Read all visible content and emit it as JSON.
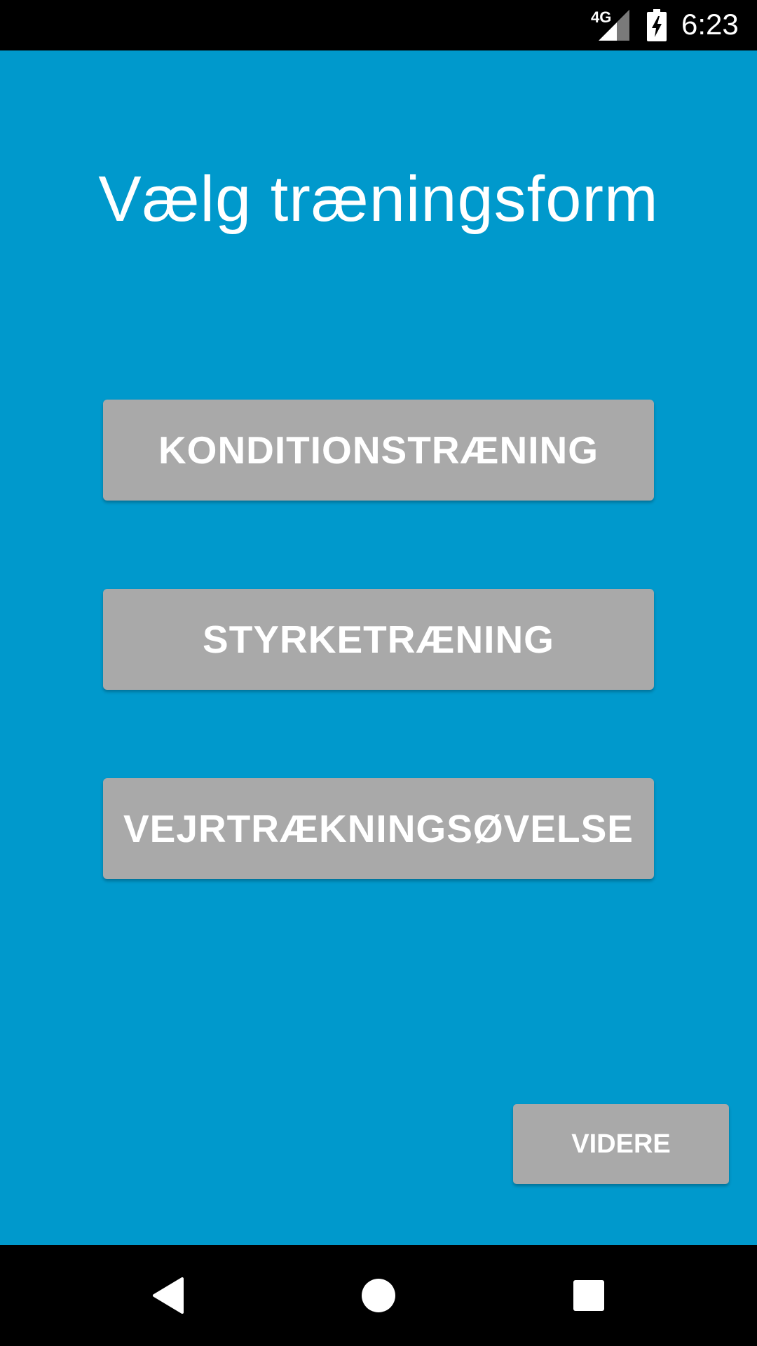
{
  "status_bar": {
    "network": "4G",
    "clock": "6:23",
    "icons": [
      "signal-icon",
      "battery-charging-icon"
    ]
  },
  "screen": {
    "title": "Vælg træningsform",
    "options": [
      {
        "label": "KONDITIONSTRÆNING"
      },
      {
        "label": "STYRKETRÆNING"
      },
      {
        "label": "VEJRTRÆKNINGSØVELSE"
      }
    ],
    "next_label": "VIDERE"
  },
  "nav_bar": {
    "icons": [
      "back-icon",
      "home-icon",
      "recents-icon"
    ]
  },
  "colors": {
    "background": "#0099CC",
    "button": "#A9A9A9",
    "text": "#FFFFFF",
    "bars": "#000000"
  }
}
